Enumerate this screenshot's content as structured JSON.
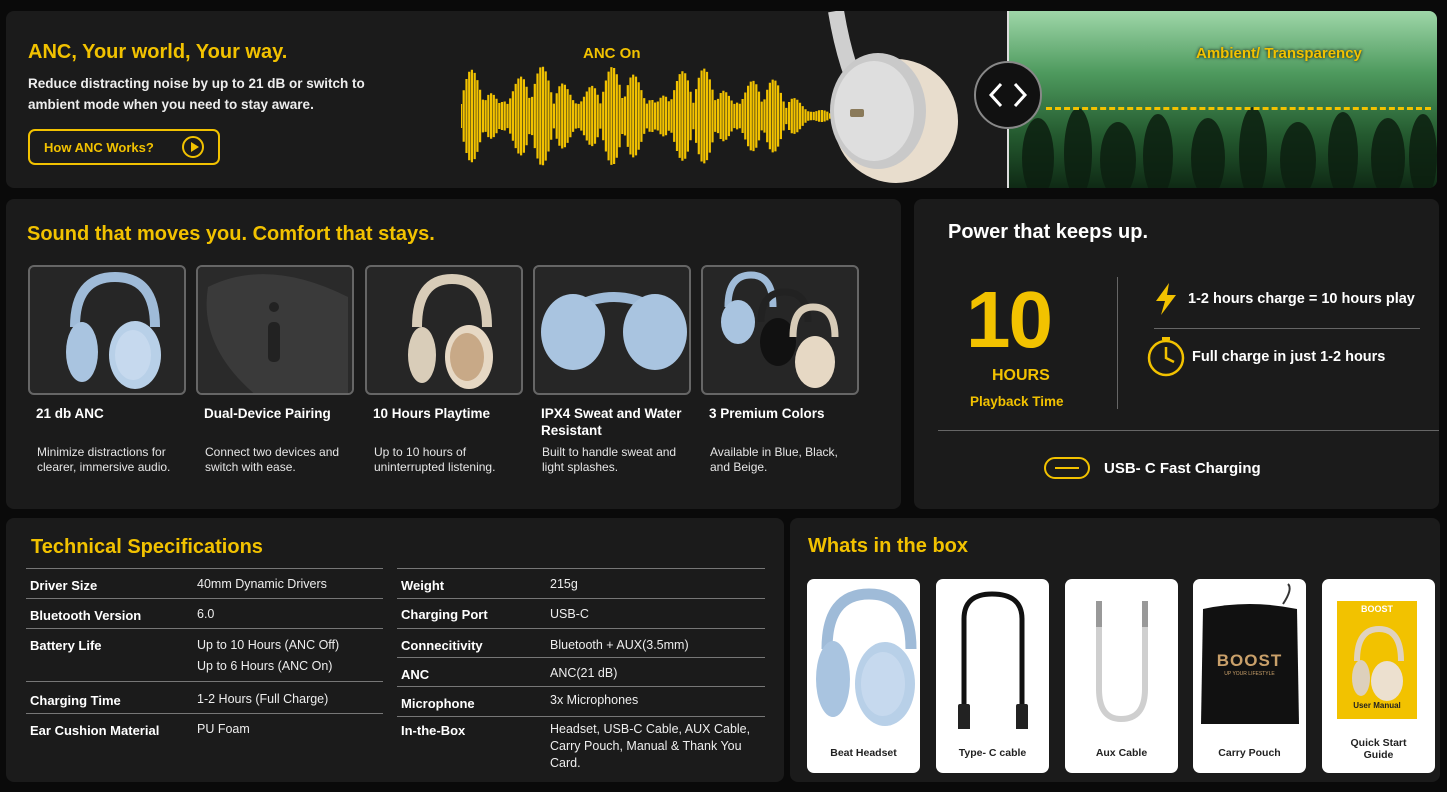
{
  "anc": {
    "title": "ANC, Your world, Your way.",
    "description": "Reduce distracting noise by up to 21 dB or switch to ambient mode when you need to stay aware.",
    "button_label": "How ANC Works?",
    "anc_on_label": "ANC On",
    "ambient_label": "Ambient/ Transparency"
  },
  "sound": {
    "title": "Sound that moves you. Comfort that stays.",
    "features": [
      {
        "title": "21 db ANC",
        "desc": "Minimize distractions for clearer, immersive audio."
      },
      {
        "title": "Dual-Device Pairing",
        "desc": "Connect two devices and switch with ease."
      },
      {
        "title": "10 Hours Playtime",
        "desc": "Up to 10 hours of uninterrupted listening."
      },
      {
        "title": "IPX4 Sweat and Water Resistant",
        "desc": "Built to handle sweat and light splashes."
      },
      {
        "title": "3 Premium Colors",
        "desc": "Available in Blue, Black, and Beige."
      }
    ]
  },
  "power": {
    "title": "Power that keeps up.",
    "big_number": "10",
    "hours": "HOURS",
    "playback": "Playback Time",
    "charge_line": "1-2 hours charge = 10 hours play",
    "full_charge_line": "Full charge in just 1-2 hours",
    "usb_label": "USB- C Fast Charging"
  },
  "specs": {
    "title": "Technical Specifications",
    "left": [
      {
        "key": "Driver Size",
        "values": [
          "40mm Dynamic Drivers"
        ]
      },
      {
        "key": "Bluetooth Version",
        "values": [
          "6.0"
        ]
      },
      {
        "key": "Battery Life",
        "values": [
          "Up to 10 Hours (ANC Off)",
          "Up to 6 Hours (ANC On)"
        ]
      },
      {
        "key": "Charging Time",
        "values": [
          "1-2 Hours (Full Charge)"
        ]
      },
      {
        "key": "Ear Cushion Material",
        "values": [
          "PU Foam"
        ]
      }
    ],
    "right": [
      {
        "key": "Weight",
        "values": [
          "215g"
        ]
      },
      {
        "key": "Charging Port",
        "values": [
          "USB-C"
        ]
      },
      {
        "key": "Connecitivity",
        "values": [
          "Bluetooth + AUX(3.5mm)"
        ]
      },
      {
        "key": "ANC",
        "values": [
          "ANC(21 dB)"
        ]
      },
      {
        "key": "Microphone",
        "values": [
          "3x Microphones"
        ]
      },
      {
        "key": "In-the-Box",
        "values": [
          "Headset, USB-C Cable, AUX Cable,",
          "Carry Pouch, Manual & Thank You",
          "Card."
        ]
      }
    ]
  },
  "box": {
    "title": "Whats in the box",
    "items": [
      {
        "label": "Beat Headset"
      },
      {
        "label": "Type- C cable"
      },
      {
        "label": "Aux Cable"
      },
      {
        "label": "Carry Pouch"
      },
      {
        "label": "Quick Start Guide"
      }
    ],
    "pouch_brand": "BOOST",
    "pouch_tagline": "UP YOUR LIFESTYLE",
    "manual_brand": "BOOST",
    "manual_label": "User Manual"
  },
  "colors": {
    "accent": "#f2c200",
    "panel": "#1b1b1b",
    "headset_blue": "#a9c4e0",
    "headset_beige": "#e6d8c4"
  }
}
